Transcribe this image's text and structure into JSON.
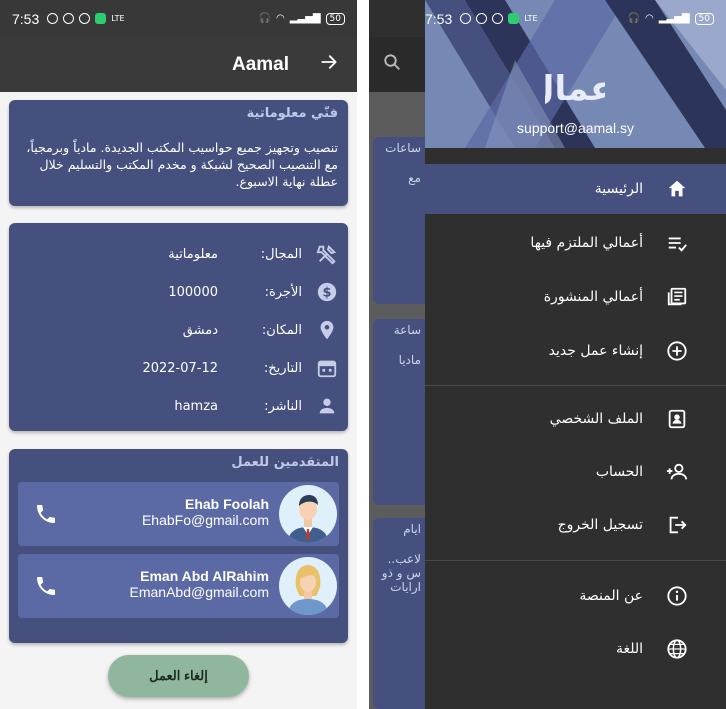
{
  "status": {
    "time": "7:53",
    "battery": "50"
  },
  "job": {
    "app_title": "Aamal",
    "description_heading": "فنّي معلوماتية",
    "description": "تنصيب وتجهيز جميع حواسيب المكتب الجديدة. مادياً وبرمجياً، مع التنصيب الصحيح لشبكة و مخدم المكتب والتسليم خلال عطلة نهاية الاسبوع.",
    "details": [
      {
        "label": "المجال:",
        "value": "معلوماتية",
        "icon": "tools-icon"
      },
      {
        "label": "الأجرة:",
        "value": "100000",
        "icon": "dollar-icon"
      },
      {
        "label": "المكان:",
        "value": "دمشق",
        "icon": "location-pin-icon"
      },
      {
        "label": "التاريخ:",
        "value": "2022-07-12",
        "icon": "calendar-icon"
      },
      {
        "label": "الناشر:",
        "value": "hamza",
        "icon": "person-icon"
      }
    ],
    "applicants_heading": "المتقدمين للعمل",
    "applicants": [
      {
        "name": "Ehab Foolah",
        "email": "EhabFo@gmail.com"
      },
      {
        "name": "Eman Abd AlRahim",
        "email": "EmanAbd@gmail.com"
      }
    ],
    "cancel_label": "إلغاء العمل"
  },
  "background": {
    "cards": [
      "ساعات",
      "مع",
      "ساعة",
      "ماديا",
      "ايام",
      "لاعب..",
      "س و ذو",
      "ارايات"
    ]
  },
  "drawer": {
    "logo_text": "أعمال",
    "email": "support@aamal.sy",
    "items": [
      {
        "label": "الرئيسية",
        "icon": "home-icon"
      },
      {
        "label": "أعمالي الملتزم فيها",
        "icon": "playlist-check-icon"
      },
      {
        "label": "أعمالي المنشورة",
        "icon": "newspaper-icon"
      },
      {
        "label": "إنشاء عمل جديد",
        "icon": "add-circle-icon"
      },
      {
        "label": "الملف الشخصي",
        "icon": "profile-badge-icon"
      },
      {
        "label": "الحساب",
        "icon": "person-add-icon"
      },
      {
        "label": "تسجيل الخروج",
        "icon": "logout-icon"
      },
      {
        "label": "عن المنصة",
        "icon": "info-icon"
      },
      {
        "label": "اللغة",
        "icon": "globe-icon"
      }
    ]
  }
}
